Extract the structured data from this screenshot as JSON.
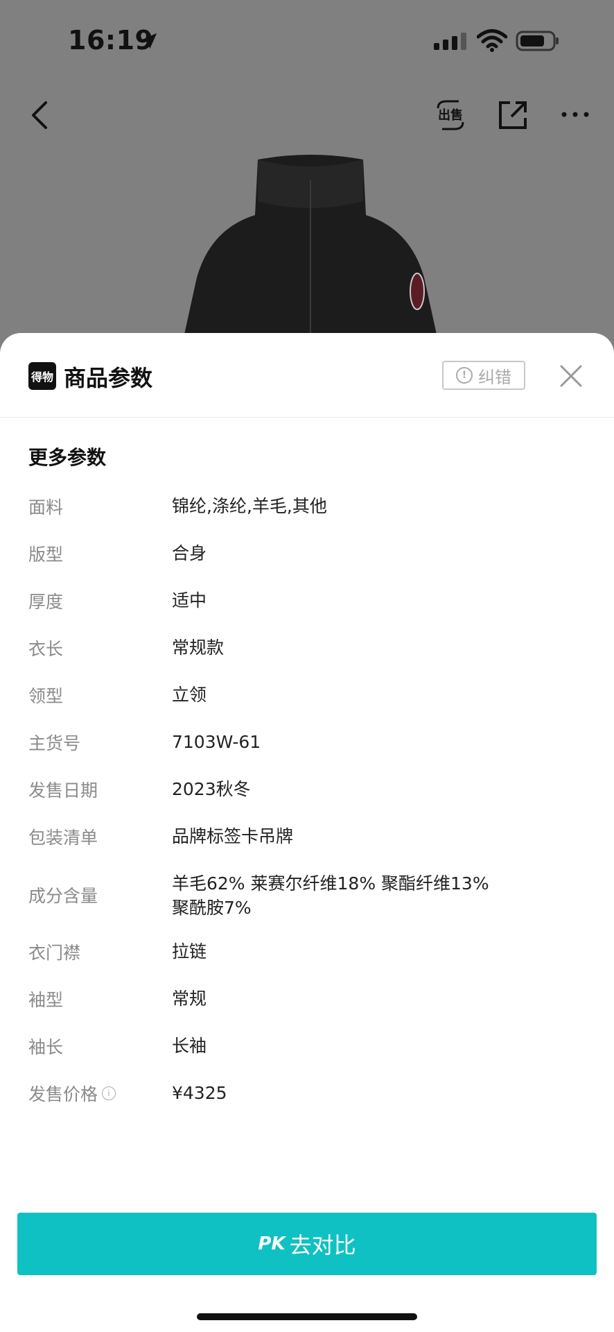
{
  "status_bar": {
    "time": "16:19"
  },
  "sheet": {
    "brand_logo_text": "得物",
    "title": "商品参数",
    "report_label": "纠错",
    "section_title": "更多参数"
  },
  "params": [
    {
      "label": "面料",
      "value": "锦纶,涤纶,羊毛,其他"
    },
    {
      "label": "版型",
      "value": "合身"
    },
    {
      "label": "厚度",
      "value": "适中"
    },
    {
      "label": "衣长",
      "value": "常规款"
    },
    {
      "label": "领型",
      "value": "立领"
    },
    {
      "label": "主货号",
      "value": "7103W-61"
    },
    {
      "label": "发售日期",
      "value": "2023秋冬"
    },
    {
      "label": "包装清单",
      "value": "品牌标签卡吊牌"
    },
    {
      "label": "成分含量",
      "value": "羊毛62% 莱赛尔纤维18% 聚酯纤维13% 聚酰胺7%"
    },
    {
      "label": "衣门襟",
      "value": "拉链"
    },
    {
      "label": "袖型",
      "value": "常规"
    },
    {
      "label": "袖长",
      "value": "长袖"
    },
    {
      "label": "发售价格",
      "value": "¥4325"
    }
  ],
  "pk_button": {
    "mark": "PK",
    "label": "去对比"
  },
  "colors": {
    "accent": "#0fc1c3",
    "overlay": "#808080"
  }
}
